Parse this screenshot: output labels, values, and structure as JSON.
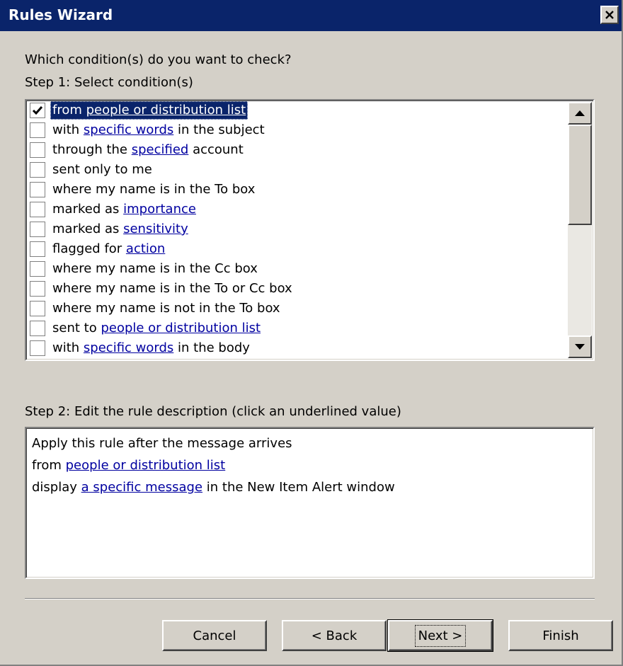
{
  "window": {
    "title": "Rules Wizard"
  },
  "prompt": "Which condition(s) do you want to check?",
  "step1_label": "Step 1: Select condition(s)",
  "conditions": [
    {
      "checked": true,
      "selected": true,
      "parts": [
        {
          "t": "from ",
          "link": false
        },
        {
          "t": "people or distribution list",
          "link": true
        }
      ]
    },
    {
      "checked": false,
      "parts": [
        {
          "t": "with ",
          "link": false
        },
        {
          "t": "specific words",
          "link": true
        },
        {
          "t": " in the subject",
          "link": false
        }
      ]
    },
    {
      "checked": false,
      "parts": [
        {
          "t": "through the ",
          "link": false
        },
        {
          "t": "specified",
          "link": true
        },
        {
          "t": " account",
          "link": false
        }
      ]
    },
    {
      "checked": false,
      "parts": [
        {
          "t": "sent only to me",
          "link": false
        }
      ]
    },
    {
      "checked": false,
      "parts": [
        {
          "t": "where my name is in the To box",
          "link": false
        }
      ]
    },
    {
      "checked": false,
      "parts": [
        {
          "t": "marked as ",
          "link": false
        },
        {
          "t": "importance",
          "link": true
        }
      ]
    },
    {
      "checked": false,
      "parts": [
        {
          "t": "marked as ",
          "link": false
        },
        {
          "t": "sensitivity",
          "link": true
        }
      ]
    },
    {
      "checked": false,
      "parts": [
        {
          "t": "flagged for ",
          "link": false
        },
        {
          "t": "action",
          "link": true
        }
      ]
    },
    {
      "checked": false,
      "parts": [
        {
          "t": "where my name is in the Cc box",
          "link": false
        }
      ]
    },
    {
      "checked": false,
      "parts": [
        {
          "t": "where my name is in the To or Cc box",
          "link": false
        }
      ]
    },
    {
      "checked": false,
      "parts": [
        {
          "t": "where my name is not in the To box",
          "link": false
        }
      ]
    },
    {
      "checked": false,
      "parts": [
        {
          "t": "sent to ",
          "link": false
        },
        {
          "t": "people or distribution list",
          "link": true
        }
      ]
    },
    {
      "checked": false,
      "parts": [
        {
          "t": "with ",
          "link": false
        },
        {
          "t": "specific words",
          "link": true
        },
        {
          "t": " in the body",
          "link": false
        }
      ]
    }
  ],
  "step2_label": "Step 2: Edit the rule description (click an underlined value)",
  "description": [
    [
      {
        "t": "Apply this rule after the message arrives",
        "link": false
      }
    ],
    [
      {
        "t": "from ",
        "link": false
      },
      {
        "t": "people or distribution list",
        "link": true
      }
    ],
    [
      {
        "t": "display ",
        "link": false
      },
      {
        "t": "a specific message",
        "link": true
      },
      {
        "t": " in the New Item Alert window",
        "link": false
      }
    ]
  ],
  "buttons": {
    "cancel": "Cancel",
    "back": "< Back",
    "next": "Next >",
    "finish": "Finish"
  },
  "colors": {
    "titlebar": "#0a246a",
    "face": "#d4d0c8",
    "link": "#0000a0",
    "selection": "#0a246a"
  }
}
